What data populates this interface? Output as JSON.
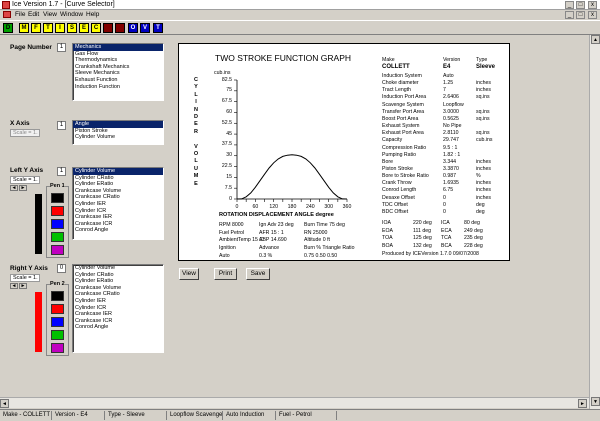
{
  "window": {
    "title": "Ice Version 1.7 - [Curve Selector]",
    "controls": [
      "_",
      "□",
      "x"
    ],
    "menu_controls": [
      "_",
      "□",
      "x"
    ]
  },
  "menu": [
    "File",
    "Edit",
    "View",
    "Window",
    "Help"
  ],
  "toolbar": [
    {
      "label": "D",
      "bg": "#00a000",
      "fg": "#000"
    },
    {
      "label": "M",
      "bg": "#ffff00",
      "fg": "#000"
    },
    {
      "label": "F",
      "bg": "#ffff00",
      "fg": "#000"
    },
    {
      "label": "T",
      "bg": "#ffff00",
      "fg": "#000"
    },
    {
      "label": "I",
      "bg": "#ffff00",
      "fg": "#000"
    },
    {
      "label": "S",
      "bg": "#ffff00",
      "fg": "#000"
    },
    {
      "label": "E",
      "bg": "#ffff00",
      "fg": "#000"
    },
    {
      "label": "C",
      "bg": "#ffff00",
      "fg": "#000"
    },
    {
      "label": "",
      "bg": "#800000",
      "fg": "#fff"
    },
    {
      "label": "",
      "bg": "#800000",
      "fg": "#fff"
    },
    {
      "label": "O",
      "bg": "#0000c0",
      "fg": "#fff"
    },
    {
      "label": "V",
      "bg": "#0000c0",
      "fg": "#fff"
    },
    {
      "label": "T",
      "bg": "#0000c0",
      "fg": "#fff"
    }
  ],
  "page_number": {
    "label": "Page Number",
    "value": "1",
    "items": [
      "Mechanics",
      "Gas Flow",
      "Thermodynamics",
      "Crankshaft Mechanics",
      "Sleeve Mechanics",
      "Exhaust Function",
      "Induction Function"
    ]
  },
  "x_axis": {
    "label": "X Axis",
    "scale": "Scale = 1.",
    "value": "1",
    "items": [
      "Angle",
      "Piston Stroke",
      "Cylinder Volume"
    ]
  },
  "left_y": {
    "label": "Left  Y Axis",
    "scale": "Scale = 1.",
    "value": "1",
    "pen_label": "Pen 1",
    "items": [
      "Cylinder Volume",
      "Cylinder CRatio",
      "Cylinder ERatio",
      "Crankcase Volume",
      "Crankcase CRatio",
      "Cylinder IER",
      "Cylinder ICR",
      "Crankcase IER",
      "Crankcase ICR",
      "Conrod Angle"
    ]
  },
  "right_y": {
    "label": "Right  Y Axis",
    "scale": "Scale = 1.",
    "value": "0",
    "pen_label": "Pen 2",
    "items": [
      "Cylinder Volume",
      "Cylinder CRatio",
      "Cylinder ERatio",
      "Crankcase Volume",
      "Crankcase CRatio",
      "Cylinder IER",
      "Cylinder ICR",
      "Crankcase IER",
      "Crankcase ICR",
      "Conrod Angle"
    ]
  },
  "pens": [
    "#000000",
    "#ff0000",
    "#0000ff",
    "#00c000",
    "#c000c0"
  ],
  "graph": {
    "title": "TWO STROKE FUNCTION GRAPH",
    "yunit": "cub.ins",
    "ylabel_letters": [
      "C",
      "Y",
      "L",
      "I",
      "N",
      "D",
      "E",
      "R",
      "",
      "V",
      "O",
      "L",
      "U",
      "M",
      "E"
    ],
    "xlabel": "ROTATION DISPLACEMENT ANGLE  degree"
  },
  "chart_data": {
    "type": "line",
    "title": "TWO STROKE FUNCTION GRAPH",
    "xlabel": "ROTATION DISPLACEMENT ANGLE  degree",
    "ylabel": "CYLINDER VOLUME",
    "yunit": "cub.ins",
    "xlim": [
      0,
      360
    ],
    "ylim": [
      0,
      82.5
    ],
    "xticks": [
      "0",
      "30",
      "60",
      "90",
      "120",
      "150",
      "180",
      "210",
      "240",
      "270",
      "300",
      "330",
      "360"
    ],
    "xtick_labels": [
      "0",
      "60",
      "120",
      "180",
      "240",
      "300",
      "360"
    ],
    "yticks": [
      "82.5",
      "75",
      "67.5",
      "60",
      "52.5",
      "45",
      "37.5",
      "30",
      "22.5",
      "15",
      "7.5",
      "0"
    ],
    "series": [
      {
        "x": [
          0,
          15,
          30,
          45,
          60,
          75,
          90,
          105,
          120,
          135,
          150,
          165,
          180,
          195,
          210,
          225,
          240,
          255,
          270,
          285,
          300,
          315,
          330,
          345,
          360
        ],
        "y": [
          0,
          0.1,
          1.5,
          4.2,
          8.1,
          12.6,
          17.1,
          21.5,
          25.1,
          27.8,
          29.5,
          30.4,
          30.7,
          30.4,
          29.5,
          27.8,
          25.1,
          21.5,
          17.1,
          12.6,
          8.1,
          4.2,
          1.5,
          0.1,
          0
        ]
      }
    ]
  },
  "params_bottom": {
    "lines": [
      [
        "RPM 8000",
        "Ign Adv  23 deg",
        "Burn Time  75 deg"
      ],
      [
        "Fuel Petrol",
        "AFR  15 : 1",
        "RN  25000"
      ],
      [
        "AmbientTemp 15 C",
        "ABP 14.690",
        "Altitude  0  ft"
      ],
      [
        "Ignition",
        "Advance",
        "Burn %  Triangle Ratio"
      ],
      [
        "Auto",
        "0.3 %",
        "0.75     0.50     0.50"
      ]
    ]
  },
  "spec": {
    "header": [
      "Make",
      "Version",
      "Type"
    ],
    "values": [
      "COLLETT",
      "E4",
      "Sleeve"
    ],
    "rows": [
      [
        "Induction System",
        "Auto",
        ""
      ],
      [
        "Choke diameter",
        "1.25",
        "inches"
      ],
      [
        "Tract Length",
        "7",
        "inches"
      ],
      [
        "Induction Port Area",
        "2.6406",
        "sq.ins"
      ],
      [
        "Scavenge System",
        "Loopflow",
        ""
      ],
      [
        "Transfer Port Area",
        "3.0000",
        "sq.ins"
      ],
      [
        "Boost Port Area",
        "0.5625",
        "sq.ins"
      ],
      [
        "Exhaust System",
        "No Pipe",
        ""
      ],
      [
        "Exhaust Port Area",
        "2.8110",
        "sq.ins"
      ],
      [
        "Capacity",
        "29.747",
        "cub.ins"
      ],
      [
        "Compression Ratio",
        "9.5 : 1",
        ""
      ],
      [
        "Pumping Ratio",
        "1.82 : 1",
        ""
      ],
      [
        "Bore",
        "3.344",
        "inches"
      ],
      [
        "Piston Stroke",
        "3.3870",
        "inches"
      ],
      [
        "Bore to Stroke Ratio",
        "0.987",
        "%"
      ],
      [
        "Crank Throw",
        "1.6935",
        "inches"
      ],
      [
        "Conrod Length",
        "6.75",
        "inches"
      ],
      [
        "Desaxe Offset",
        "0",
        "inches"
      ],
      [
        "TDC Offset",
        "0",
        "deg"
      ],
      [
        "BDC Offset",
        "0",
        "deg"
      ]
    ],
    "timing": [
      [
        "IOA",
        "220  deg",
        "ICA",
        "80  deg"
      ],
      [
        "EOA",
        "111  deg",
        "ECA",
        "249  deg"
      ],
      [
        "TOA",
        "125  deg",
        "TCA",
        "235  deg"
      ],
      [
        "BOA",
        "132  deg",
        "BCA",
        "228  deg"
      ]
    ],
    "footer": "Produced by ICEVersion 1.7.0    09/07/2008"
  },
  "buttons": {
    "view": "View",
    "print": "Print",
    "save": "Save"
  },
  "status": [
    "Make - COLLETT",
    "Version - E4",
    "Type - Sleeve",
    "Loopflow Scavenge",
    "Auto Induction",
    "Fuel - Petrol"
  ]
}
